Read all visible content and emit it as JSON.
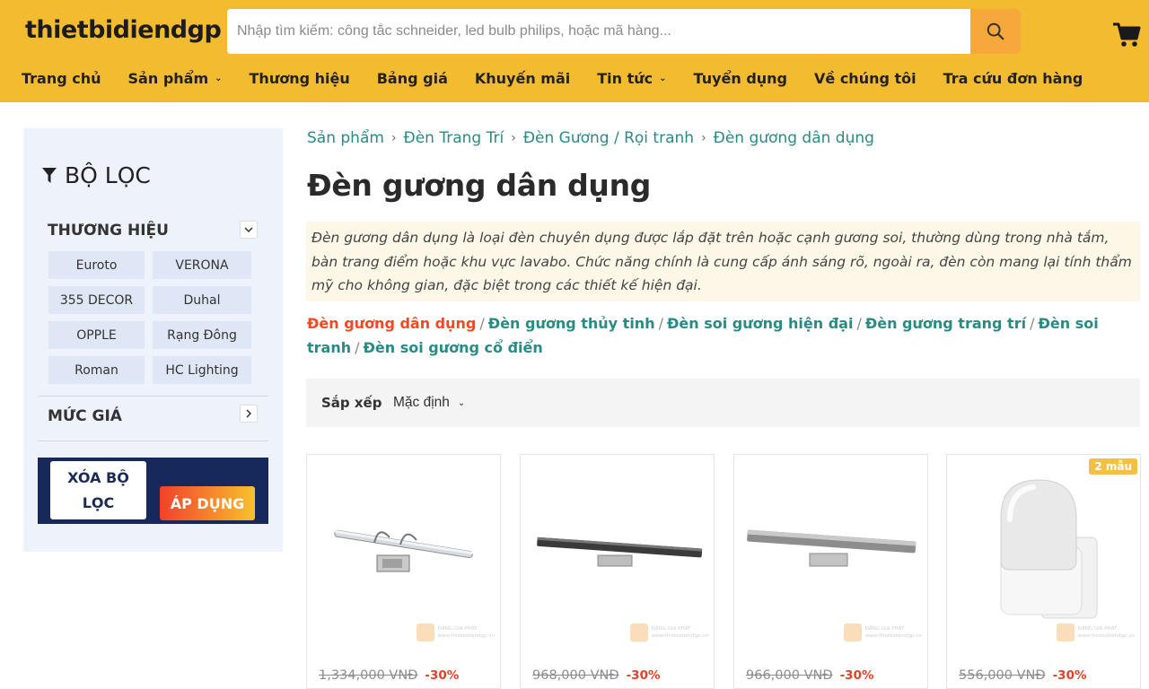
{
  "header": {
    "logo": "thietbidiendgp",
    "search_placeholder": "Nhập tìm kiếm: công tắc schneider, led bulb philips, hoặc mã hàng...",
    "accent_color": "#f3bb2f",
    "search_button_color": "#f6a83a"
  },
  "nav": {
    "items": [
      {
        "label": "Trang chủ",
        "dropdown": false
      },
      {
        "label": "Sản phẩm",
        "dropdown": true
      },
      {
        "label": "Thương hiệu",
        "dropdown": false
      },
      {
        "label": "Bảng giá",
        "dropdown": false
      },
      {
        "label": "Khuyến mãi",
        "dropdown": false
      },
      {
        "label": "Tin tức",
        "dropdown": true
      },
      {
        "label": "Tuyển dụng",
        "dropdown": false
      },
      {
        "label": "Về chúng tôi",
        "dropdown": false
      },
      {
        "label": "Tra cứu đơn hàng",
        "dropdown": false
      }
    ]
  },
  "sidebar": {
    "title": "BỘ LỌC",
    "brand_section": "THƯƠNG HIỆU",
    "brands": [
      "Euroto",
      "VERONA",
      "355 DECOR",
      "Duhal",
      "OPPLE",
      "Rạng Đông",
      "Roman",
      "HC Lighting"
    ],
    "price_section": "MỨC GIÁ",
    "clear_label": "XÓA BỘ LỌC",
    "apply_label": "ÁP DỤNG"
  },
  "main": {
    "breadcrumb": [
      "Sản phẩm",
      "Đèn Trang Trí",
      "Đèn Gương / Rọi tranh",
      "Đèn gương dân dụng"
    ],
    "title": "Đèn gương dân dụng",
    "description": "Đèn gương dân dụng là loại đèn chuyên dụng được lắp đặt trên hoặc cạnh gương soi, thường dùng trong nhà tắm, bàn trang điểm hoặc khu vực lavabo. Chức năng chính là cung cấp ánh sáng rõ, ngoài ra, đèn còn mang lại tính thẩm mỹ cho không gian, đặc biệt trong các thiết kế hiện đại.",
    "subcategories": [
      "Đèn gương dân dụng",
      "Đèn gương thủy tinh",
      "Đèn soi gương hiện đại",
      "Đèn gương trang trí",
      "Đèn soi tranh",
      "Đèn soi gương cổ điển"
    ],
    "sort_label": "Sắp xếp",
    "sort_value": "Mặc định"
  },
  "products": [
    {
      "old_price": "1,334,000 VNĐ",
      "discount": "-30%",
      "badge": ""
    },
    {
      "old_price": "968,000 VNĐ",
      "discount": "-30%",
      "badge": ""
    },
    {
      "old_price": "966,000 VNĐ",
      "discount": "-30%",
      "badge": ""
    },
    {
      "old_price": "556,000 VNĐ",
      "discount": "-30%",
      "badge": "2 mẫu"
    }
  ],
  "watermark": {
    "line1": "ĐĂNG GIA PHÁT",
    "line2": "www.thietbidiendgp.vn"
  }
}
